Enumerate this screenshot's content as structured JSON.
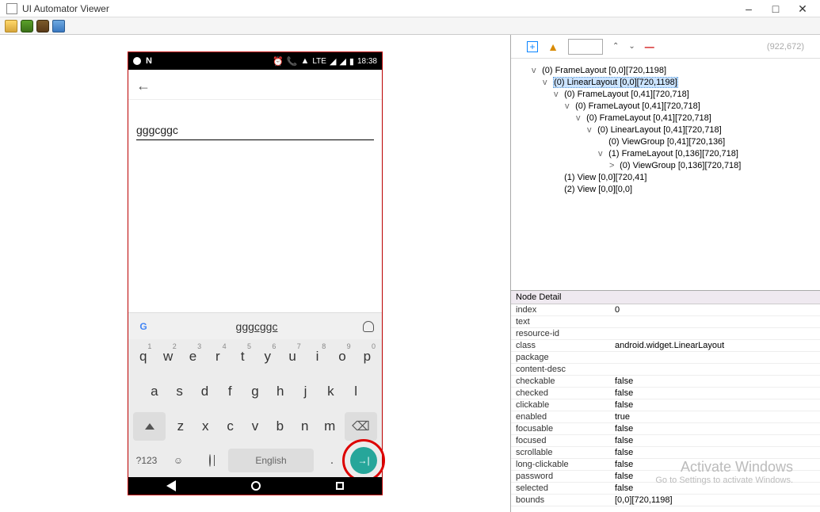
{
  "window": {
    "title": "UI Automator Viewer"
  },
  "device": {
    "status": {
      "time": "18:38",
      "lte": "LTE"
    },
    "input_text": "gggcggc",
    "keyboard": {
      "suggestion": "gggcggc",
      "row1": [
        {
          "l": "q",
          "s": "1"
        },
        {
          "l": "w",
          "s": "2"
        },
        {
          "l": "e",
          "s": "3"
        },
        {
          "l": "r",
          "s": "4"
        },
        {
          "l": "t",
          "s": "5"
        },
        {
          "l": "y",
          "s": "6"
        },
        {
          "l": "u",
          "s": "7"
        },
        {
          "l": "i",
          "s": "8"
        },
        {
          "l": "o",
          "s": "9"
        },
        {
          "l": "p",
          "s": "0"
        }
      ],
      "row2": [
        "a",
        "s",
        "d",
        "f",
        "g",
        "h",
        "j",
        "k",
        "l"
      ],
      "row3": [
        "z",
        "x",
        "c",
        "v",
        "b",
        "n",
        "m"
      ],
      "sym_label": "?123",
      "space_label": "English"
    }
  },
  "tree": {
    "dims_hint": "(922,672)",
    "nodes": [
      {
        "d": 0,
        "tog": "v",
        "t": "(0) FrameLayout [0,0][720,1198]"
      },
      {
        "d": 1,
        "tog": "v",
        "t": "(0) LinearLayout [0,0][720,1198]",
        "sel": true
      },
      {
        "d": 2,
        "tog": "v",
        "t": "(0) FrameLayout [0,41][720,718]"
      },
      {
        "d": 3,
        "tog": "v",
        "t": "(0) FrameLayout [0,41][720,718]"
      },
      {
        "d": 4,
        "tog": "v",
        "t": "(0) FrameLayout [0,41][720,718]"
      },
      {
        "d": 5,
        "tog": "v",
        "t": "(0) LinearLayout [0,41][720,718]"
      },
      {
        "d": 6,
        "tog": "",
        "t": "(0) ViewGroup [0,41][720,136]"
      },
      {
        "d": 6,
        "tog": "v",
        "t": "(1) FrameLayout [0,136][720,718]"
      },
      {
        "d": 7,
        "tog": ">",
        "t": "(0) ViewGroup [0,136][720,718]"
      },
      {
        "d": 2,
        "tog": "",
        "t": "(1) View [0,0][720,41]"
      },
      {
        "d": 2,
        "tog": "",
        "t": "(2) View [0,0][0,0]"
      }
    ]
  },
  "detail": {
    "header": "Node Detail",
    "rows": [
      {
        "k": "index",
        "v": "0"
      },
      {
        "k": "text",
        "v": ""
      },
      {
        "k": "resource-id",
        "v": ""
      },
      {
        "k": "class",
        "v": "android.widget.LinearLayout"
      },
      {
        "k": "package",
        "v": ""
      },
      {
        "k": "content-desc",
        "v": ""
      },
      {
        "k": "checkable",
        "v": "false"
      },
      {
        "k": "checked",
        "v": "false"
      },
      {
        "k": "clickable",
        "v": "false"
      },
      {
        "k": "enabled",
        "v": "true"
      },
      {
        "k": "focusable",
        "v": "false"
      },
      {
        "k": "focused",
        "v": "false"
      },
      {
        "k": "scrollable",
        "v": "false"
      },
      {
        "k": "long-clickable",
        "v": "false"
      },
      {
        "k": "password",
        "v": "false"
      },
      {
        "k": "selected",
        "v": "false"
      },
      {
        "k": "bounds",
        "v": "[0,0][720,1198]"
      }
    ]
  },
  "watermark": {
    "l1": "Activate Windows",
    "l2": "Go to Settings to activate Windows."
  }
}
